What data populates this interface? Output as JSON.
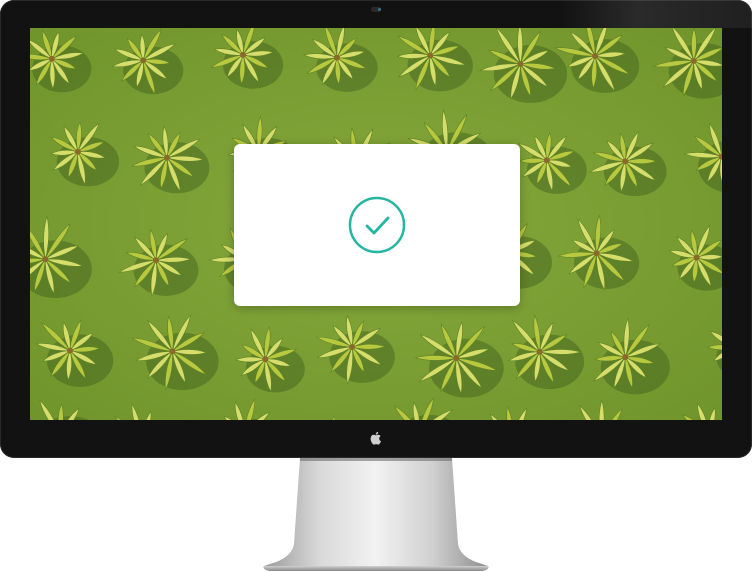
{
  "device": {
    "type": "desktop-monitor",
    "logo_icon": "apple-logo-icon"
  },
  "wallpaper": {
    "description_icon": "palm-trees-aerial-wallpaper",
    "colors": {
      "grass": "#7a9f34",
      "grass_dark": "#5e8425",
      "frond": "#b9c93f",
      "frond_light": "#d6dd6a",
      "shadow": "#3f5e1c"
    }
  },
  "dialog": {
    "icon": "check-circle-icon",
    "accent_color": "#26b5a0"
  }
}
